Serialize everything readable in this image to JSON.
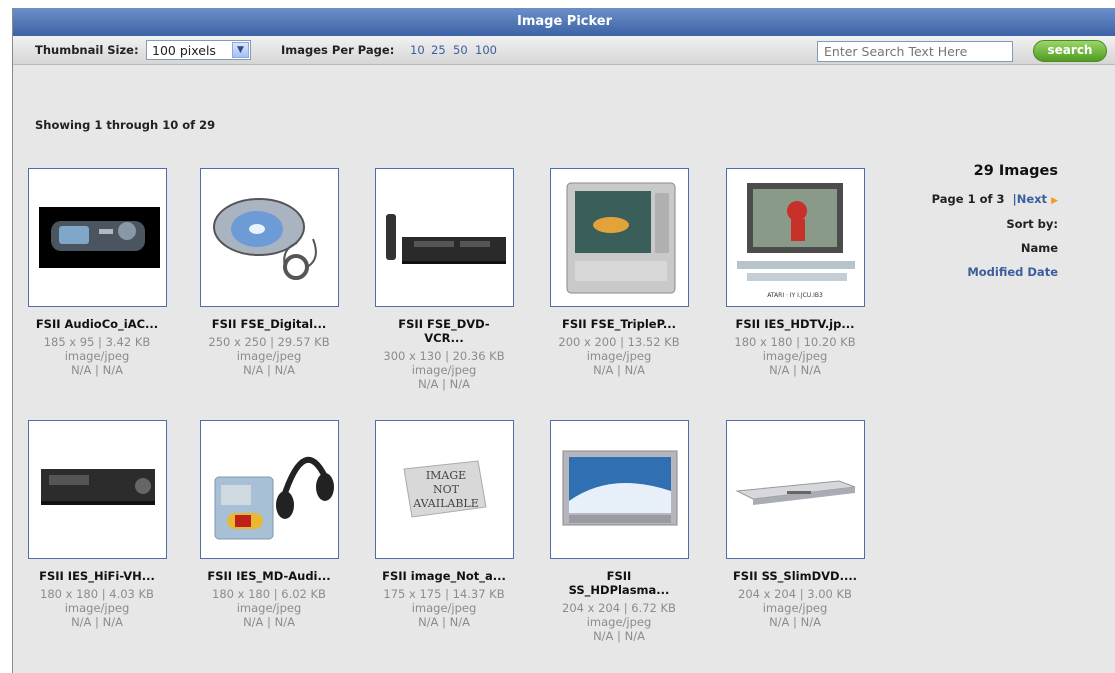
{
  "window": {
    "title": "Image Picker"
  },
  "toolbar": {
    "thumb_size_label": "Thumbnail Size:",
    "thumb_size_value": "100 pixels",
    "per_page_label": "Images Per Page:",
    "per_page_options": [
      "10",
      "25",
      "50",
      "100"
    ],
    "search_placeholder": "Enter Search Text Here",
    "search_button": "search"
  },
  "results": {
    "showing": "Showing 1 through 10 of 29"
  },
  "side": {
    "count": "29 Images",
    "page": "Page 1 of 3",
    "next": "|Next",
    "sort_label": "Sort by:",
    "sort_name": "Name",
    "sort_modified": "Modified Date"
  },
  "images": [
    {
      "name": "FSII AudioCo_iAC...",
      "dims": "185 x 95 | 3.42 KB",
      "type": "image/jpeg",
      "extra": "N/A | N/A",
      "icon": "mp3-player-icon"
    },
    {
      "name": "FSII FSE_Digital...",
      "dims": "250 x 250 | 29.57 KB",
      "type": "image/jpeg",
      "extra": "N/A | N/A",
      "icon": "cd-player-icon"
    },
    {
      "name": "FSII FSE_DVD-VCR...",
      "name_lines": [
        "FSII FSE_DVD-",
        "VCR..."
      ],
      "dims": "300 x 130 | 20.36 KB",
      "type": "image/jpeg",
      "extra": "N/A | N/A",
      "icon": "dvd-vcr-icon"
    },
    {
      "name": "FSII FSE_TripleP...",
      "dims": "200 x 200 | 13.52 KB",
      "type": "image/jpeg",
      "extra": "N/A | N/A",
      "icon": "crt-tv-icon"
    },
    {
      "name": "FSII IES_HDTV.jp...",
      "dims": "180 x 180 | 10.20 KB",
      "type": "image/jpeg",
      "extra": "N/A | N/A",
      "icon": "hdtv-icon",
      "caption": "ATARI · IY I.JCU.IB3"
    },
    {
      "name": "FSII IES_HiFi-VH...",
      "dims": "180 x 180 | 4.03 KB",
      "type": "image/jpeg",
      "extra": "N/A | N/A",
      "icon": "vcr-icon"
    },
    {
      "name": "FSII IES_MD-Audi...",
      "dims": "180 x 180 | 6.02 KB",
      "type": "image/jpeg",
      "extra": "N/A | N/A",
      "icon": "minidisc-headphones-icon"
    },
    {
      "name": "FSII image_Not_a...",
      "dims": "175 x 175 | 14.37 KB",
      "type": "image/jpeg",
      "extra": "N/A | N/A",
      "icon": "image-not-available-icon",
      "placeholder_text": [
        "IMAGE",
        "NOT",
        "AVAILABLE"
      ]
    },
    {
      "name": "FSII SS_HDPlasma...",
      "name_lines": [
        "FSII",
        "SS_HDPlasma..."
      ],
      "dims": "204 x 204 | 6.72 KB",
      "type": "image/jpeg",
      "extra": "N/A | N/A",
      "icon": "plasma-tv-icon"
    },
    {
      "name": "FSII SS_SlimDVD....",
      "dims": "204 x 204 | 3.00 KB",
      "type": "image/jpeg",
      "extra": "N/A | N/A",
      "icon": "slim-dvd-icon"
    }
  ],
  "colors": {
    "title_bar": "#3c63a6",
    "link": "#3b5e9c",
    "thumb_border": "#4d6ea8",
    "search_button": "#4f9c20",
    "next_arrow": "#f59a1c"
  }
}
